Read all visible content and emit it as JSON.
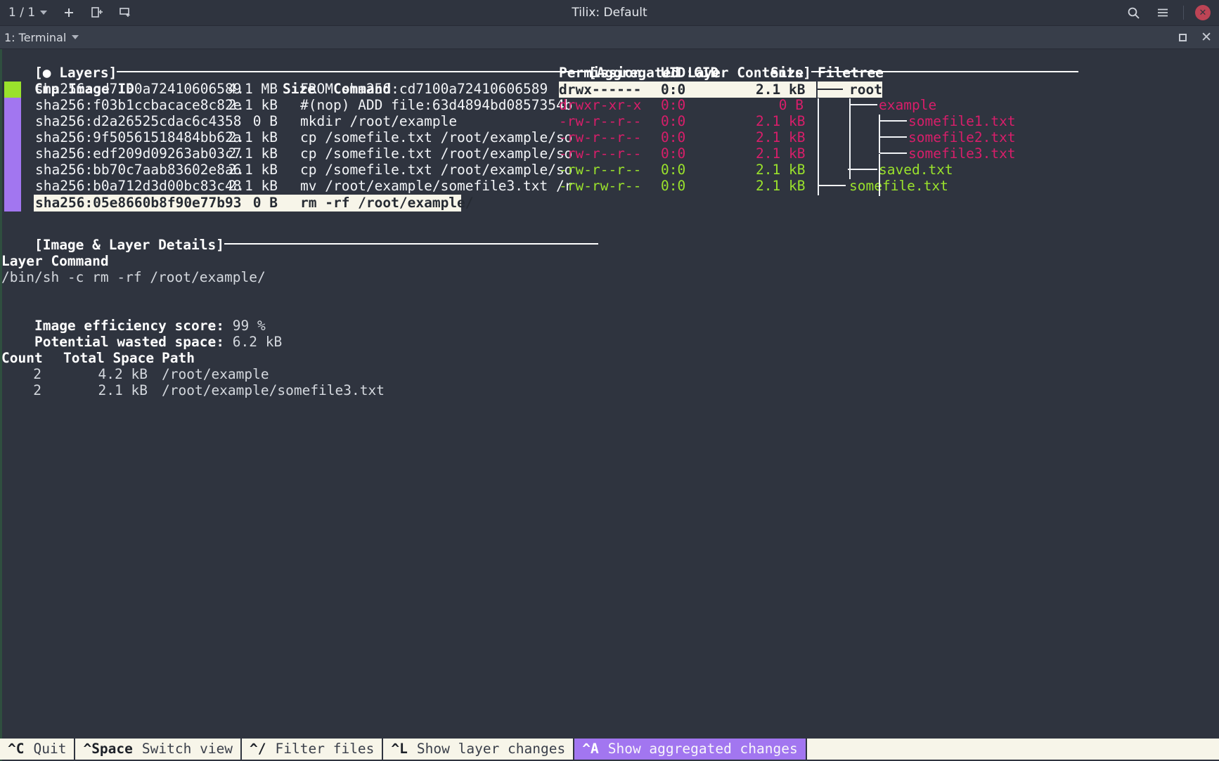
{
  "titlebar": {
    "session_counter": "1 / 1",
    "window_title": "Tilix: Default",
    "icons": {
      "session_caret": "chevron-down-icon",
      "add": "+",
      "split_vertical": "split-vertical-icon",
      "split_horizontal": "split-horizontal-icon",
      "search": "search-icon",
      "menu": "hamburger-menu-icon",
      "close": "✕"
    }
  },
  "tabbar": {
    "title": "1: Terminal",
    "caret": "chevron-down-icon",
    "maximize": "maximize-icon",
    "close": "✕"
  },
  "layers_pane": {
    "title": "[● Layers]",
    "columns": [
      "Cmp",
      "Image ID",
      "Size",
      "Command"
    ],
    "rows": [
      {
        "cmp": "add",
        "id": "sha256:cd7100a72410606589",
        "size": "4.1 MB",
        "command": "FROM sha256:cd7100a72410606589",
        "selected": false
      },
      {
        "cmp": "mod",
        "id": "sha256:f03b1ccbacace8c82e",
        "size": "2.1 kB",
        "command": "#(nop) ADD file:63d4894bd0857354b",
        "selected": false
      },
      {
        "cmp": "mod",
        "id": "sha256:d2a26525cdac6c4358",
        "size": "0 B",
        "command": "mkdir /root/example",
        "selected": false
      },
      {
        "cmp": "mod",
        "id": "sha256:9f50561518484bb62a",
        "size": "2.1 kB",
        "command": "cp /somefile.txt /root/example/so",
        "selected": false
      },
      {
        "cmp": "mod",
        "id": "sha256:edf209d09263ab03c7",
        "size": "2.1 kB",
        "command": "cp /somefile.txt /root/example/so",
        "selected": false
      },
      {
        "cmp": "mod",
        "id": "sha256:bb70c7aab83602e8a6",
        "size": "2.1 kB",
        "command": "cp /somefile.txt /root/example/so",
        "selected": false
      },
      {
        "cmp": "mod",
        "id": "sha256:b0a712d3d00bc83c48",
        "size": "2.1 kB",
        "command": "mv /root/example/somefile3.txt /r",
        "selected": false
      },
      {
        "cmp": "mod",
        "id": "sha256:05e8660b8f90e77b93",
        "size": "0 B",
        "command": "rm -rf /root/example/",
        "selected": true
      }
    ]
  },
  "contents_pane": {
    "title": "[Aggregated Layer Contents]",
    "columns": [
      "Permission",
      "UID:GID",
      "Size",
      "Filetree"
    ],
    "rows": [
      {
        "perm": "drwx------",
        "uidgid": "0:0",
        "size": "2.1 kB",
        "tree_prefix": "─── ",
        "name": "root",
        "state": "selected"
      },
      {
        "perm": "drwxr-xr-x",
        "uidgid": "0:0",
        "size": "0 B",
        "tree_prefix": "   ├── ",
        "name": "example",
        "state": "removed"
      },
      {
        "perm": "-rw-r--r--",
        "uidgid": "0:0",
        "size": "2.1 kB",
        "tree_prefix": "   │   ├── ",
        "name": "somefile1.txt",
        "state": "removed"
      },
      {
        "perm": "-rw-r--r--",
        "uidgid": "0:0",
        "size": "2.1 kB",
        "tree_prefix": "   │   ├── ",
        "name": "somefile2.txt",
        "state": "removed"
      },
      {
        "perm": "-rw-r--r--",
        "uidgid": "0:0",
        "size": "2.1 kB",
        "tree_prefix": "   │   └── ",
        "name": "somefile3.txt",
        "state": "removed"
      },
      {
        "perm": "-rw-r--r--",
        "uidgid": "0:0",
        "size": "2.1 kB",
        "tree_prefix": "   └── ",
        "name": "saved.txt",
        "state": "added"
      },
      {
        "perm": "-rw-rw-r--",
        "uidgid": "0:0",
        "size": "2.1 kB",
        "tree_prefix": "└── ",
        "name": "somefile.txt",
        "state": "added"
      }
    ]
  },
  "details_pane": {
    "title": "[Image & Layer Details]",
    "layer_command_label": "Layer Command",
    "layer_command_value": "/bin/sh -c rm -rf /root/example/",
    "efficiency_label": "Image efficiency score:",
    "efficiency_value": "99 %",
    "wasted_label": "Potential wasted space:",
    "wasted_value": "6.2 kB",
    "waste_columns": [
      "Count",
      "Total Space",
      "Path"
    ],
    "waste_rows": [
      {
        "count": "2",
        "space": "4.2 kB",
        "path": "/root/example"
      },
      {
        "count": "2",
        "space": "2.1 kB",
        "path": "/root/example/somefile3.txt"
      }
    ]
  },
  "statusbar": {
    "items": [
      {
        "key": "^C",
        "label": "Quit",
        "active": false
      },
      {
        "key": "^Space",
        "label": "Switch view",
        "active": false
      },
      {
        "key": "^/",
        "label": "Filter files",
        "active": false
      },
      {
        "key": "^L",
        "label": "Show layer changes",
        "active": false
      },
      {
        "key": "^A",
        "label": "Show aggregated changes",
        "active": true
      }
    ]
  },
  "colors": {
    "background": "#2f343f",
    "added": "#9ae22c",
    "removed": "#d81e6a",
    "modified": "#a276f0",
    "selection": "#f7f5e9",
    "accent": "#a276f0"
  }
}
